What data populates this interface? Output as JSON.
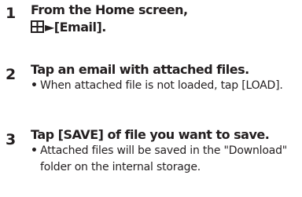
{
  "steps": [
    {
      "number": "1",
      "title_line1": "From the Home screen,",
      "title_line2": "►[Email].",
      "icon": "apps-menu-icon"
    },
    {
      "number": "2",
      "title": "Tap an email with attached files.",
      "bullet": "When attached file is not loaded, tap [LOAD].",
      "bullet_symbol": "•"
    },
    {
      "number": "3",
      "title": "Tap [SAVE] of file you want to save.",
      "bullet": "Attached files will be saved in the \"Download\" folder on the internal storage.",
      "bullet_symbol": "•"
    }
  ]
}
